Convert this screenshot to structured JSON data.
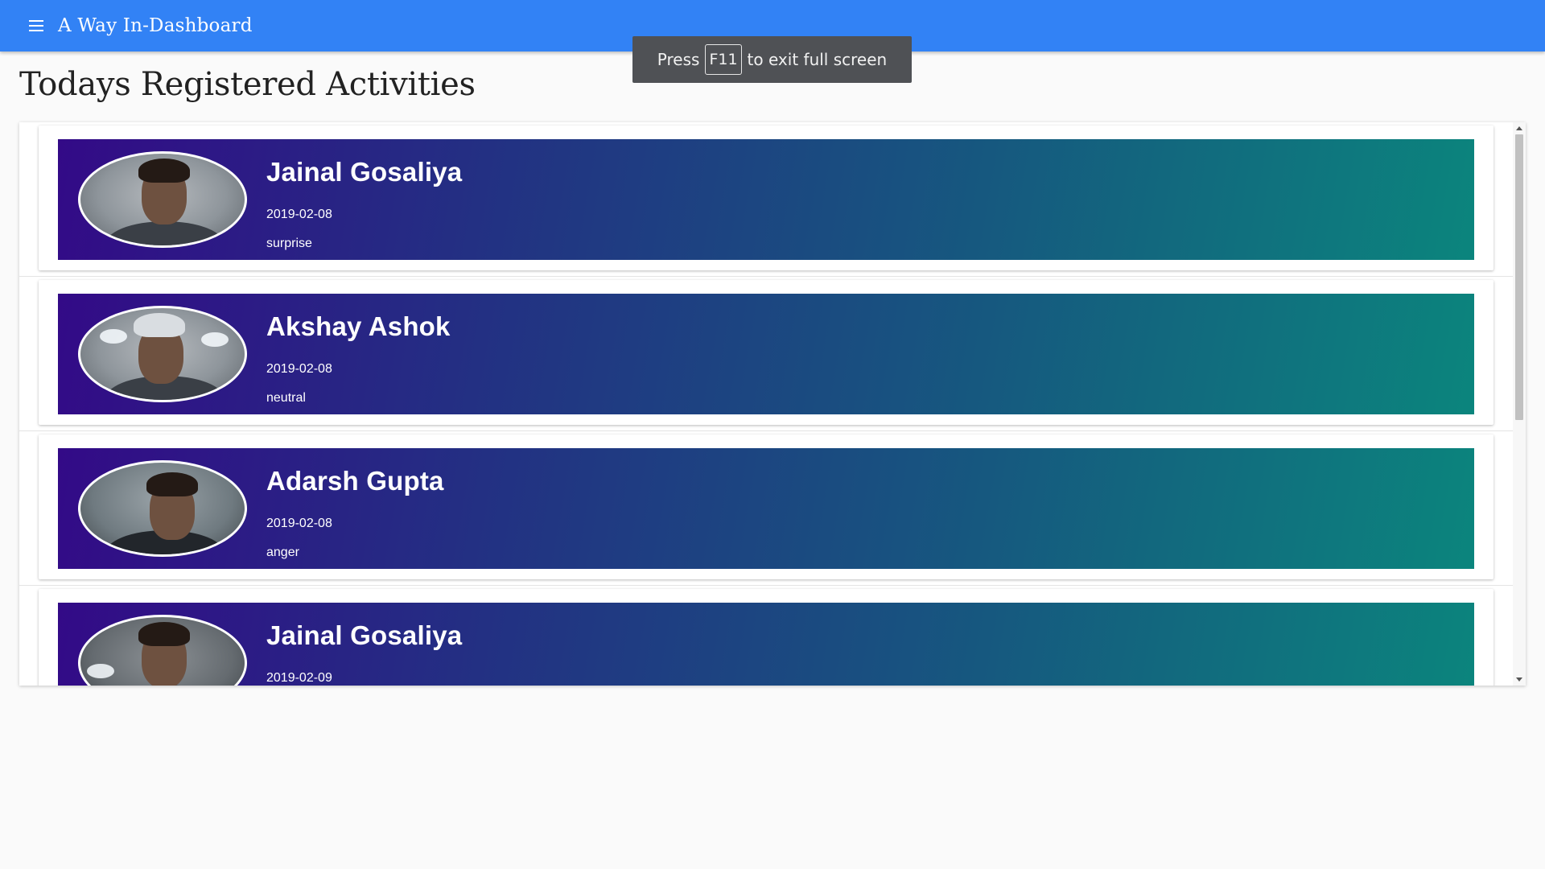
{
  "app": {
    "title": "A Way In-Dashboard",
    "menu_icon": "menu-icon",
    "bar_color": "#3282f5"
  },
  "fullscreen_notice": {
    "before": "Press",
    "key": "F11",
    "after": "to exit full screen"
  },
  "page": {
    "title": "Todays Registered Activities"
  },
  "activities": [
    {
      "name": "Jainal Gosaliya",
      "date": "2019-02-08",
      "emotion": "surprise"
    },
    {
      "name": "Akshay Ashok",
      "date": "2019-02-08",
      "emotion": "neutral"
    },
    {
      "name": "Adarsh Gupta",
      "date": "2019-02-08",
      "emotion": "anger"
    },
    {
      "name": "Jainal Gosaliya",
      "date": "2019-02-09",
      "emotion": ""
    }
  ],
  "colors": {
    "card_gradient_start": "#330a87",
    "card_gradient_end": "#0b857d"
  }
}
